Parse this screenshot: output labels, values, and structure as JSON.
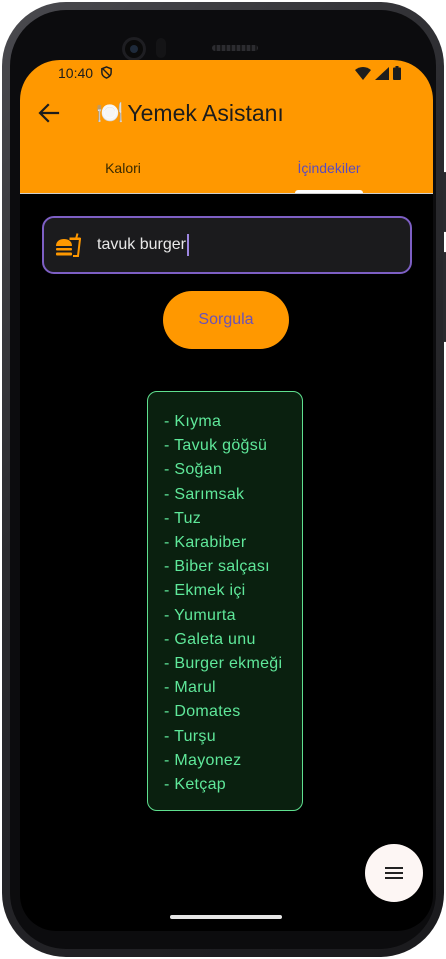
{
  "status_bar": {
    "time": "10:40"
  },
  "app_bar": {
    "title": "Yemek Asistanı",
    "title_emoji": "🍽️"
  },
  "tabs": [
    {
      "label": "Kalori",
      "selected": false
    },
    {
      "label": "İçindekiler",
      "selected": true
    }
  ],
  "search": {
    "value": "tavuk burger",
    "icon": "fastfood-icon"
  },
  "query_button": {
    "label": "Sorgula"
  },
  "ingredients": [
    "- Kıyma",
    "- Tavuk göğsü",
    "- Soğan",
    "- Sarımsak",
    "- Tuz",
    "- Karabiber",
    "- Biber salçası",
    "- Ekmek içi",
    "- Yumurta",
    "- Galeta unu",
    "- Burger ekmeği",
    "- Marul",
    "- Domates",
    "- Turşu",
    "- Mayonez",
    "- Ketçap"
  ],
  "fab": {
    "icon": "menu-icon"
  },
  "colors": {
    "primary": "#ff9800",
    "accent": "#7d5fc4",
    "card_border": "#5fe08f",
    "card_text": "#5fe89a",
    "background": "#000000"
  }
}
